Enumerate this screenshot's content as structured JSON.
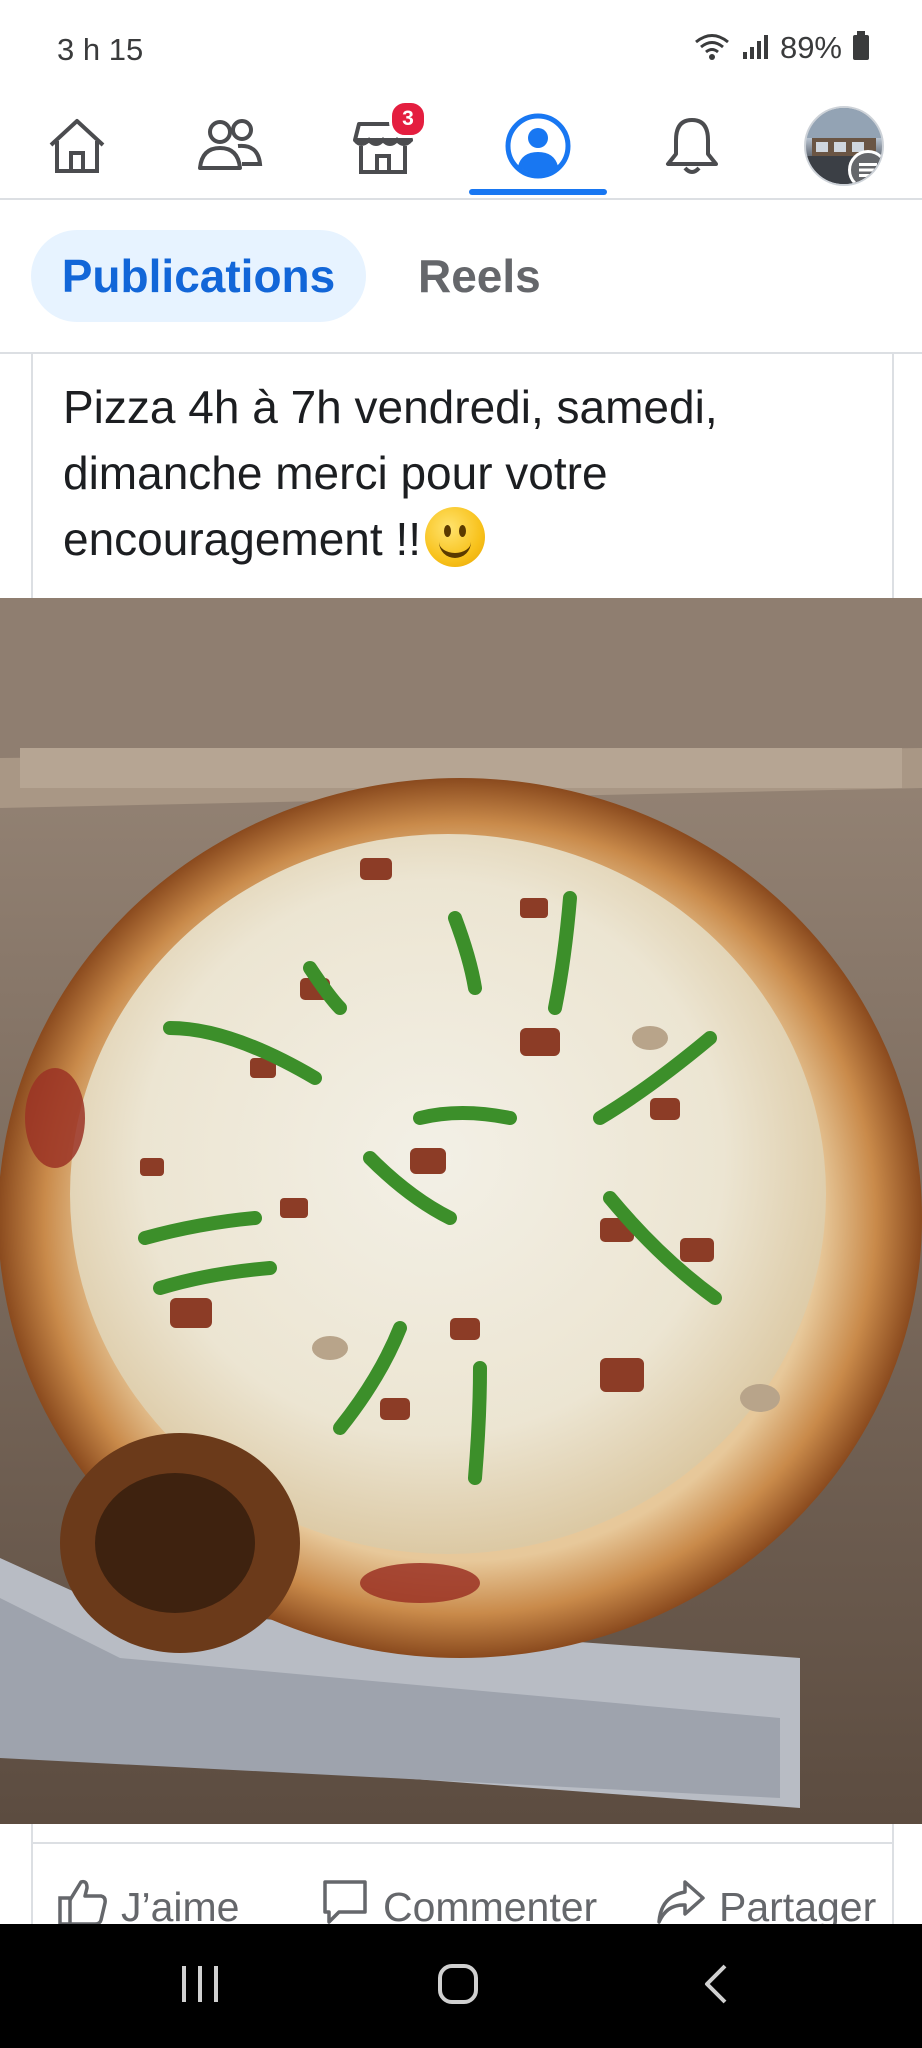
{
  "status_bar": {
    "time": "3 h 15",
    "battery": "89%"
  },
  "nav": {
    "items": [
      {
        "name": "home"
      },
      {
        "name": "friends"
      },
      {
        "name": "marketplace",
        "badge": "3"
      },
      {
        "name": "profile",
        "active": true
      },
      {
        "name": "notifications"
      },
      {
        "name": "menu-avatar"
      }
    ],
    "accent_color": "#1877f2"
  },
  "tabs": {
    "publications": "Publications",
    "reels": "Reels",
    "active": "publications"
  },
  "post": {
    "text": "Pizza 4h à 7h vendredi, samedi, dimanche merci pour votre encouragement !!",
    "emoji": "smiling-face-emoji",
    "image": "pizza-photo"
  },
  "actions": {
    "like": "J’aime",
    "comment": "Commenter",
    "share": "Partager"
  },
  "colors": {
    "badge": "#e41e3f",
    "tab_active_bg": "#e7f3ff",
    "tab_active_text": "#1266d8"
  }
}
